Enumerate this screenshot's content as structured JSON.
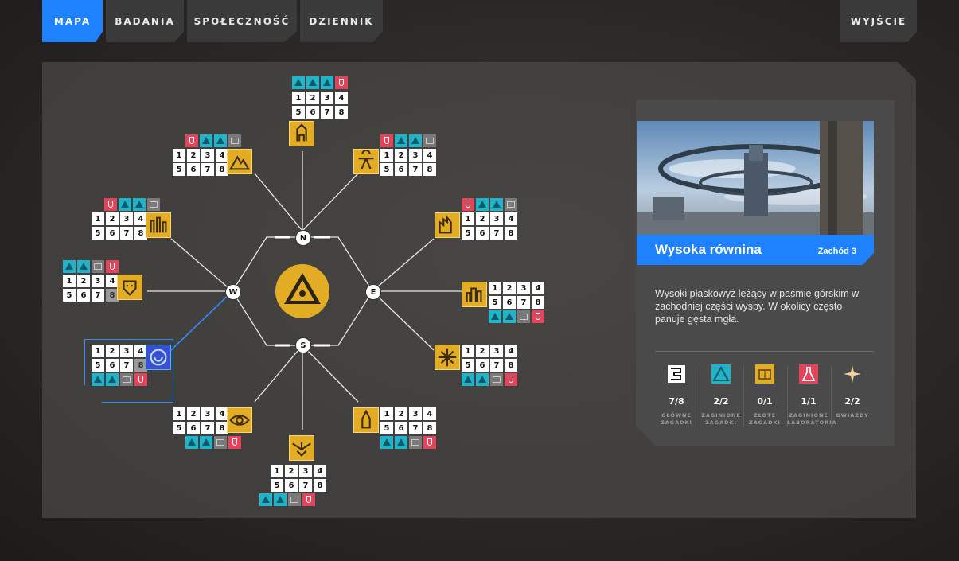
{
  "nav": {
    "tabs": [
      {
        "label": "MAPA",
        "active": true
      },
      {
        "label": "BADANIA",
        "active": false
      },
      {
        "label": "SPOŁECZNOŚĆ",
        "active": false
      },
      {
        "label": "DZIENNIK",
        "active": false
      }
    ],
    "exit_label": "WYJŚCIE"
  },
  "compass": {
    "n": "N",
    "e": "E",
    "s": "S",
    "w": "W"
  },
  "puzzle_numbers": [
    "1",
    "2",
    "3",
    "4",
    "5",
    "6",
    "7",
    "8"
  ],
  "colors": {
    "accent": "#1e82ff",
    "gold": "#e2ad24",
    "teal": "#21b3c9",
    "red": "#e2445c",
    "gray": "#7a7a7a"
  },
  "regions": [
    {
      "id": "north",
      "icon": "tower-icon",
      "badges": [
        "teal",
        "teal",
        "teal",
        "red"
      ],
      "dim": []
    },
    {
      "id": "northeast",
      "icon": "satellite-icon",
      "badges": [
        "red",
        "teal",
        "teal",
        "gray"
      ],
      "dim": []
    },
    {
      "id": "east-upper",
      "icon": "factory-icon",
      "badges": [
        "red",
        "teal",
        "teal",
        "gray"
      ],
      "dim": []
    },
    {
      "id": "east",
      "icon": "city-icon",
      "badges": [
        "teal",
        "teal",
        "gray",
        "red"
      ],
      "dim": []
    },
    {
      "id": "east-lower",
      "icon": "sun-icon",
      "badges": [
        "teal",
        "teal",
        "gray",
        "red"
      ],
      "dim": []
    },
    {
      "id": "southeast",
      "icon": "rocket-icon",
      "badges": [
        "teal",
        "teal",
        "gray",
        "red"
      ],
      "dim": []
    },
    {
      "id": "south",
      "icon": "bird-icon",
      "badges": [
        "teal",
        "teal",
        "gray",
        "red"
      ],
      "dim": []
    },
    {
      "id": "southwest",
      "icon": "eye-icon",
      "badges": [
        "teal",
        "teal",
        "gray",
        "red"
      ],
      "dim": []
    },
    {
      "id": "west-lower",
      "icon": "spiral-icon",
      "badges": [
        "teal",
        "teal",
        "gray",
        "red"
      ],
      "dim": [
        "8"
      ],
      "selected": true
    },
    {
      "id": "west",
      "icon": "mask-icon",
      "badges": [
        "teal",
        "teal",
        "gray",
        "red"
      ],
      "dim": [
        "8"
      ]
    },
    {
      "id": "west-upper",
      "icon": "ruins-icon",
      "badges": [
        "red",
        "teal",
        "teal",
        "gray"
      ],
      "dim": []
    },
    {
      "id": "northwest",
      "icon": "mountain-icon",
      "badges": [
        "red",
        "teal",
        "teal",
        "gray"
      ],
      "dim": []
    }
  ],
  "card": {
    "title": "Wysoka równina",
    "region": "Zachód 3",
    "description": "Wysoki płaskowyż leżący w paśmie górskim w zachodniej części wyspy. W okolicy często panuje gęsta mgła.",
    "stats": [
      {
        "icon": "maze-icon",
        "value": "7/8",
        "label": "GŁÓWNE ZAGADKI"
      },
      {
        "icon": "triangle-icon",
        "value": "2/2",
        "label": "ZAGINIONE ZAGADKI"
      },
      {
        "icon": "chest-icon",
        "value": "0/1",
        "label": "ZŁOTE ZAGADKI"
      },
      {
        "icon": "flask-icon",
        "value": "1/1",
        "label": "ZAGINIONE LABORATORIA"
      },
      {
        "icon": "star-icon",
        "value": "2/2",
        "label": "GWIAZDY"
      }
    ]
  }
}
